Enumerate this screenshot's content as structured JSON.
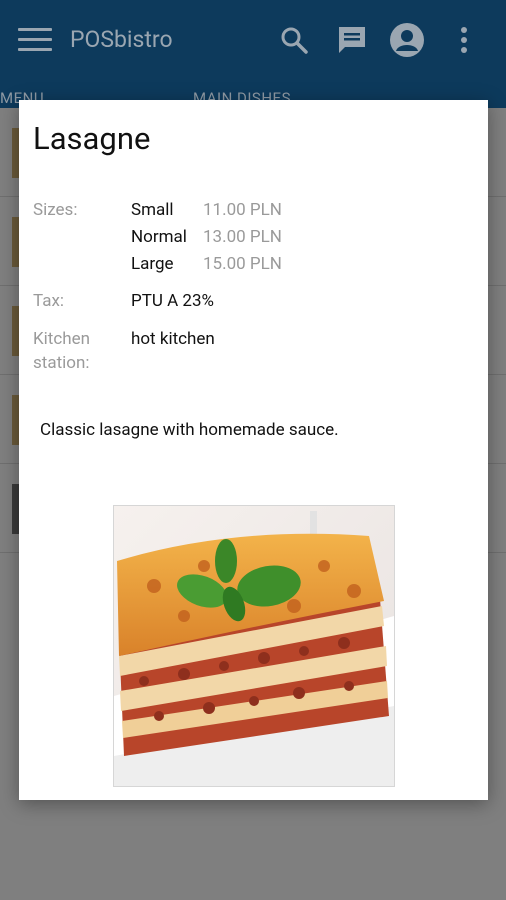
{
  "appbar": {
    "title": "POSbistro",
    "icons": [
      "menu-icon",
      "search-icon",
      "chat-icon",
      "account-icon",
      "more-vert-icon"
    ],
    "color": "#0d3a5c"
  },
  "tabs": [
    "MENU",
    "MAIN DISHES"
  ],
  "dialog": {
    "title": "Lasagne",
    "sizes_label": "Sizes:",
    "sizes": [
      {
        "name": "Small",
        "price": "11.00 PLN"
      },
      {
        "name": "Normal",
        "price": "13.00 PLN"
      },
      {
        "name": "Large",
        "price": "15.00 PLN"
      }
    ],
    "tax_label": "Tax:",
    "tax_value": "PTU A 23%",
    "station_label_line1": "Kitchen",
    "station_label_line2": "station:",
    "station_value": "hot kitchen",
    "description": "Classic lasagne with homemade sauce."
  }
}
